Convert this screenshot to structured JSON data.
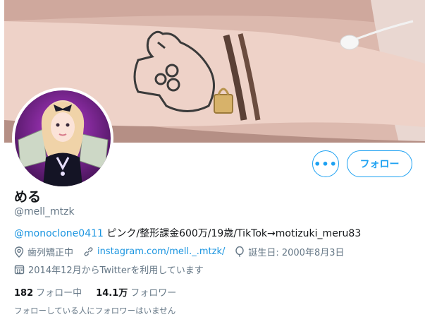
{
  "profile": {
    "display_name": "める",
    "handle": "@mell_mtzk",
    "bio_mention": "@monoclone0411",
    "bio_text": " ピンク/整形課金600万/19歳/TikTok→motizuki_meru83",
    "location": "歯列矯正中",
    "website": "instagram.com/mell._.mtzk/",
    "birthday": "誕生日: 2000年8月3日",
    "joined": "2014年12月からTwitterを利用しています"
  },
  "actions": {
    "more_label": "•••",
    "follow_label": "フォロー"
  },
  "stats": {
    "following_count": "182",
    "following_label": "フォロー中",
    "followers_count": "14.1万",
    "followers_label": "フォロワー"
  },
  "known_followers": "フォローしている人にフォロワーはいません",
  "icons": {
    "location": "location-pin-icon",
    "link": "link-icon",
    "birthday": "balloon-icon",
    "calendar": "calendar-icon"
  },
  "colors": {
    "accent": "#1da1f2",
    "link": "#1b95e0",
    "secondary_text": "#657786",
    "primary_text": "#14171a"
  }
}
